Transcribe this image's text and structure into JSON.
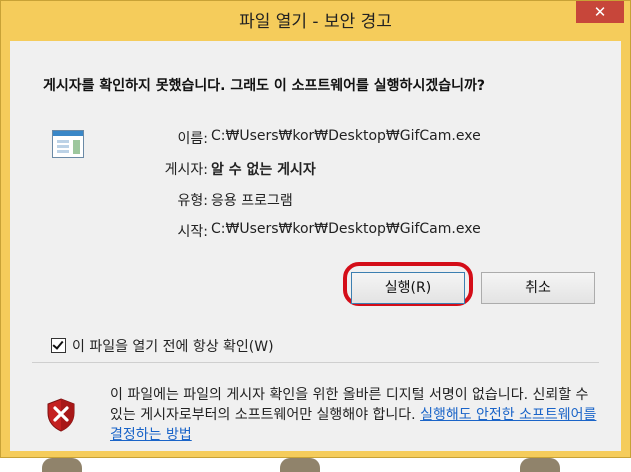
{
  "window": {
    "title": "파일 열기 - 보안 경고",
    "close_label": "✕"
  },
  "dialog": {
    "headline": "게시자를 확인하지 못했습니다. 그래도 이 소프트웨어를 실행하시겠습니까?",
    "details": [
      {
        "label": "이름:",
        "value": "C:₩Users₩kor₩Desktop₩GifCam.exe"
      },
      {
        "label": "게시자:",
        "value": "알 수 없는 게시자"
      },
      {
        "label": "유형:",
        "value": "응용 프로그램"
      },
      {
        "label": "시작:",
        "value": "C:₩Users₩kor₩Desktop₩GifCam.exe"
      }
    ],
    "buttons": {
      "run": "실행(R)",
      "cancel": "취소"
    },
    "checkbox": {
      "label": "이 파일을 열기 전에 항상 확인(W)",
      "checked": true
    },
    "footer": {
      "text": "이 파일에는 파일의 게시자 확인을 위한 올바른 디지털 서명이 없습니다. 신뢰할 수 있는 게시자로부터의 소프트웨어만 실행해야 합니다.",
      "link": "실행해도 안전한 소프트웨어를 결정하는 방법"
    }
  },
  "icons": {
    "app": "application-window-icon",
    "shield": "security-warning-shield-icon",
    "checkmark": "checkmark-icon"
  },
  "colors": {
    "frame": "#f5cc5b",
    "close_button": "#c7463a",
    "highlight": "#d40d18",
    "link": "#1a64c8"
  }
}
